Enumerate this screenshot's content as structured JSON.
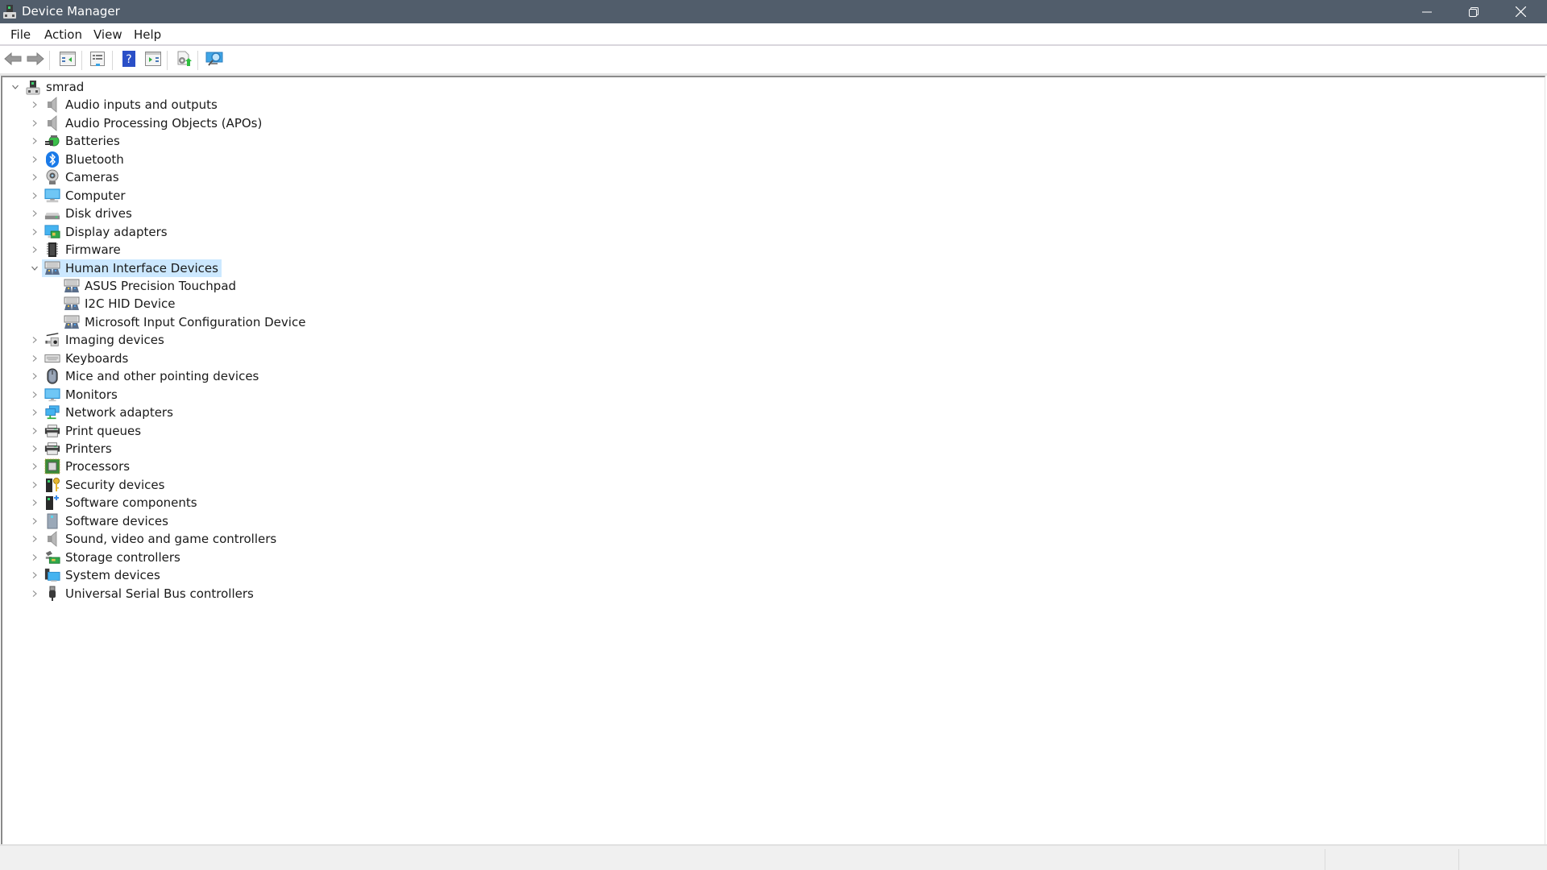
{
  "window": {
    "title": "Device Manager",
    "app_icon": "device-manager-icon",
    "controls": {
      "minimize": "minimize-icon",
      "restore": "restore-icon",
      "close": "close-icon"
    }
  },
  "menubar": {
    "items": [
      {
        "label": "File"
      },
      {
        "label": "Action"
      },
      {
        "label": "View"
      },
      {
        "label": "Help"
      }
    ]
  },
  "toolbar": {
    "buttons": [
      {
        "name": "back",
        "icon": "back-arrow-icon",
        "tooltip": "Back"
      },
      {
        "name": "forward",
        "icon": "forward-arrow-icon",
        "tooltip": "Forward"
      },
      {
        "name": "show-hide-console-tree",
        "icon": "console-tree-icon"
      },
      {
        "name": "properties",
        "icon": "properties-icon"
      },
      {
        "name": "help",
        "icon": "help-icon"
      },
      {
        "name": "show-hide-action-pane",
        "icon": "action-pane-icon"
      },
      {
        "name": "update-driver",
        "icon": "update-driver-icon"
      },
      {
        "name": "scan-hardware-changes",
        "icon": "scan-hardware-icon"
      }
    ]
  },
  "tree": {
    "root": {
      "label": "smrad",
      "expanded": true,
      "icon": "computer-tower-icon"
    },
    "categories": [
      {
        "label": "Audio inputs and outputs",
        "icon": "speaker-icon",
        "expanded": false
      },
      {
        "label": "Audio Processing Objects (APOs)",
        "icon": "speaker-icon",
        "expanded": false
      },
      {
        "label": "Batteries",
        "icon": "battery-icon",
        "expanded": false
      },
      {
        "label": "Bluetooth",
        "icon": "bluetooth-icon",
        "expanded": false
      },
      {
        "label": "Cameras",
        "icon": "camera-icon",
        "expanded": false
      },
      {
        "label": "Computer",
        "icon": "computer-icon",
        "expanded": false
      },
      {
        "label": "Disk drives",
        "icon": "disk-drive-icon",
        "expanded": false
      },
      {
        "label": "Display adapters",
        "icon": "display-adapter-icon",
        "expanded": false
      },
      {
        "label": "Firmware",
        "icon": "firmware-chip-icon",
        "expanded": false
      },
      {
        "label": "Human Interface Devices",
        "icon": "hid-icon",
        "expanded": true,
        "selected": true,
        "children": [
          {
            "label": "ASUS Precision Touchpad",
            "icon": "hid-icon"
          },
          {
            "label": "I2C HID Device",
            "icon": "hid-icon"
          },
          {
            "label": "Microsoft Input Configuration Device",
            "icon": "hid-icon"
          }
        ]
      },
      {
        "label": "Imaging devices",
        "icon": "imaging-device-icon",
        "expanded": false
      },
      {
        "label": "Keyboards",
        "icon": "keyboard-icon",
        "expanded": false
      },
      {
        "label": "Mice and other pointing devices",
        "icon": "mouse-icon",
        "expanded": false
      },
      {
        "label": "Monitors",
        "icon": "monitor-icon",
        "expanded": false
      },
      {
        "label": "Network adapters",
        "icon": "network-adapter-icon",
        "expanded": false
      },
      {
        "label": "Print queues",
        "icon": "printer-icon",
        "expanded": false
      },
      {
        "label": "Printers",
        "icon": "printer-icon",
        "expanded": false
      },
      {
        "label": "Processors",
        "icon": "processor-icon",
        "expanded": false
      },
      {
        "label": "Security devices",
        "icon": "security-device-icon",
        "expanded": false
      },
      {
        "label": "Software components",
        "icon": "software-component-icon",
        "expanded": false
      },
      {
        "label": "Software devices",
        "icon": "software-device-icon",
        "expanded": false
      },
      {
        "label": "Sound, video and game controllers",
        "icon": "speaker-icon",
        "expanded": false
      },
      {
        "label": "Storage controllers",
        "icon": "storage-controller-icon",
        "expanded": false
      },
      {
        "label": "System devices",
        "icon": "system-device-icon",
        "expanded": false
      },
      {
        "label": "Universal Serial Bus controllers",
        "icon": "usb-icon",
        "expanded": false
      }
    ]
  },
  "colors": {
    "titlebar": "#515d6b",
    "selection": "#cce8ff",
    "statusbar": "#f0f0f0"
  }
}
